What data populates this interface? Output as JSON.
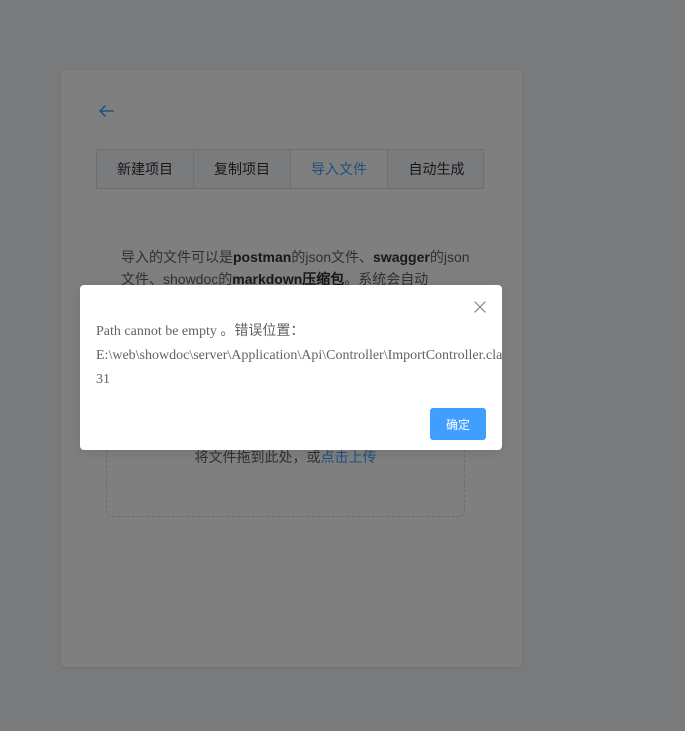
{
  "tabs": [
    {
      "label": "新建项目"
    },
    {
      "label": "复制项目"
    },
    {
      "label": "导入文件"
    },
    {
      "label": "自动生成"
    }
  ],
  "description": {
    "p1": "导入的文件可以是",
    "b1": "postman",
    "p2": "的json文件、",
    "b2": "swagger",
    "p3": "的json文件、showdoc的",
    "b3": "markdown压缩包",
    "p4": "。系统会自动"
  },
  "upload": {
    "text": "将文件拖到此处，或",
    "link": "点击上传"
  },
  "dialog": {
    "line1": "Path cannot be empty 。错误位置：",
    "line2": "E:\\web\\showdoc\\server\\Application\\Api\\Controller\\ImportController.class.php",
    "line3": "31",
    "confirm_label": "确定"
  }
}
